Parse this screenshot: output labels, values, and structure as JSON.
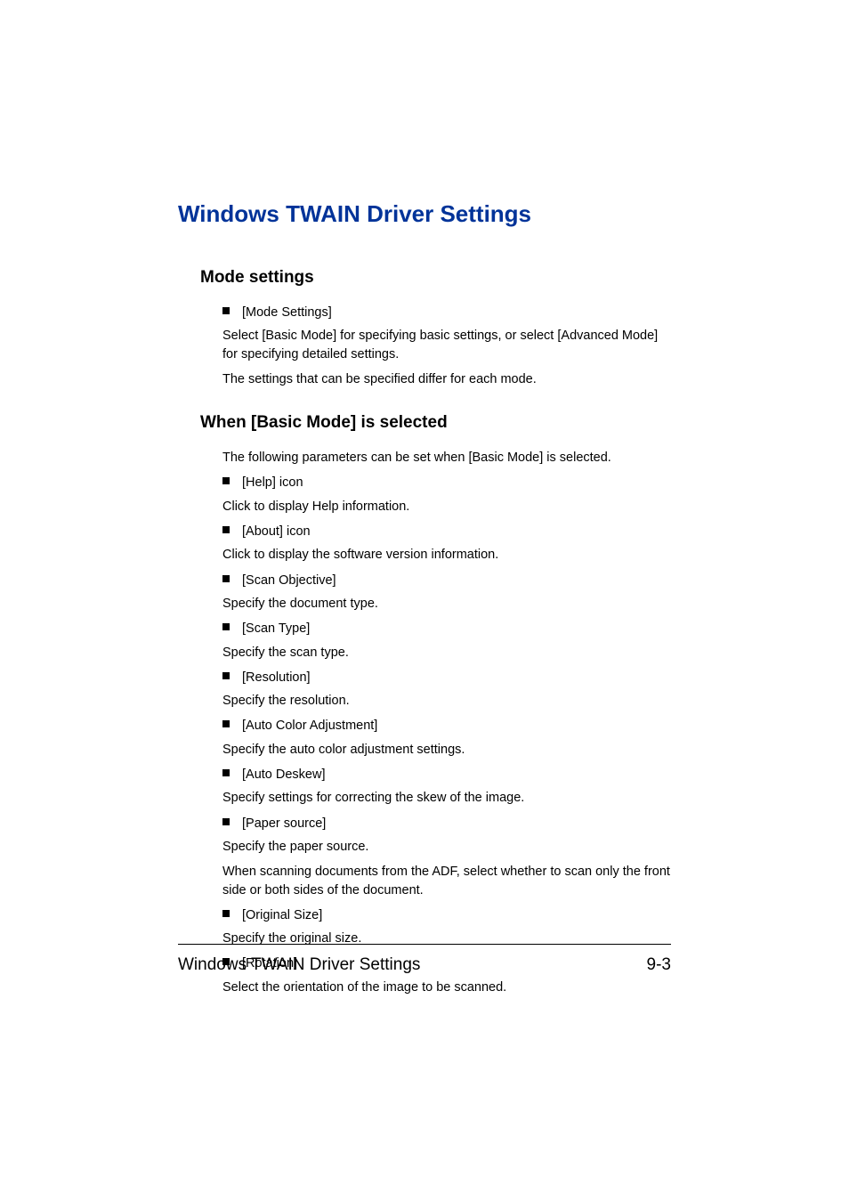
{
  "main_heading": "Windows TWAIN Driver Settings",
  "sections": {
    "mode_settings": {
      "heading": "Mode settings",
      "bullet1": "[Mode Settings]",
      "text1": "Select [Basic Mode] for specifying basic settings, or select [Advanced Mode] for specifying detailed settings.",
      "text2": "The settings that can be specified differ for each mode."
    },
    "basic_mode": {
      "heading": "When [Basic Mode] is selected",
      "intro": "The following parameters can be set when [Basic Mode] is selected.",
      "items": [
        {
          "bullet": "[Help] icon",
          "text": "Click to display Help information."
        },
        {
          "bullet": "[About] icon",
          "text": "Click to display the software version information."
        },
        {
          "bullet": "[Scan Objective]",
          "text": "Specify the document type."
        },
        {
          "bullet": "[Scan Type]",
          "text": "Specify the scan type."
        },
        {
          "bullet": "[Resolution]",
          "text": "Specify the resolution."
        },
        {
          "bullet": "[Auto Color Adjustment]",
          "text": "Specify the auto color adjustment settings."
        },
        {
          "bullet": "[Auto Deskew]",
          "text": "Specify settings for correcting the skew of the image."
        },
        {
          "bullet": "[Paper source]",
          "text": "Specify the paper source."
        }
      ],
      "paper_source_extra": "When scanning documents from the ADF, select whether to scan only the front side or both sides of the document.",
      "items2": [
        {
          "bullet": "[Original Size]",
          "text": "Specify the original size."
        },
        {
          "bullet": "[Rotation]",
          "text": "Select the orientation of the image to be scanned."
        }
      ]
    }
  },
  "footer": {
    "title": "Windows TWAIN Driver Settings",
    "page": "9-3"
  }
}
